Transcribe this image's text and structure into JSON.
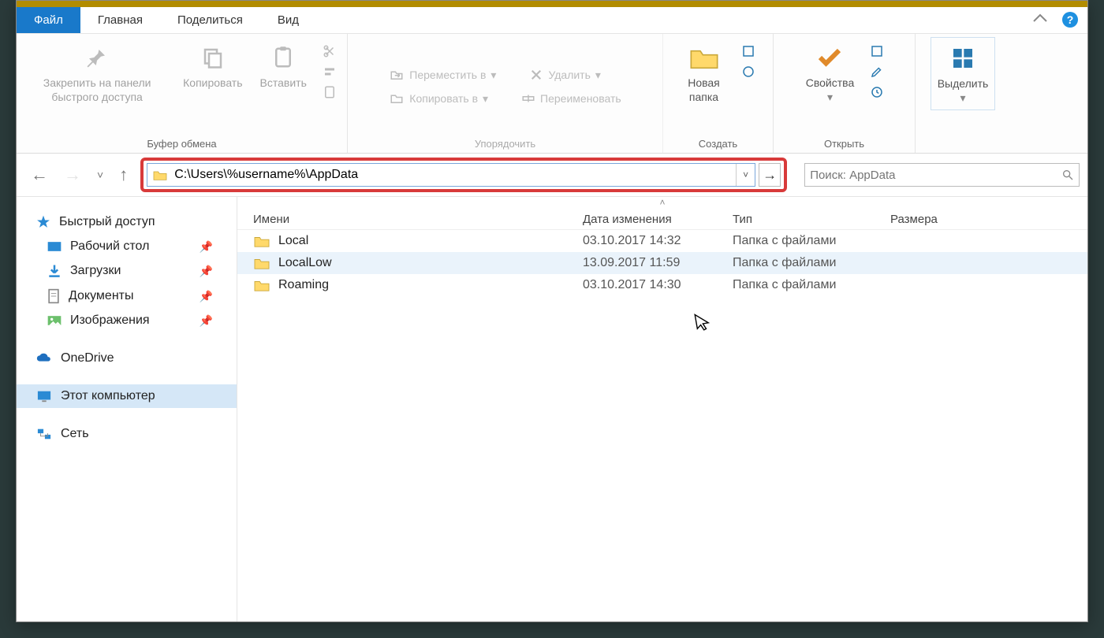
{
  "tabs": {
    "file": "Файл",
    "home": "Главная",
    "share": "Поделиться",
    "view": "Вид"
  },
  "ribbon": {
    "clipboard": {
      "pin": "Закрепить на панели\nбыстрого доступа",
      "copy": "Копировать",
      "paste": "Вставить",
      "label": "Буфер обмена"
    },
    "organize": {
      "moveTo": "Переместить в",
      "copyTo": "Копировать в",
      "delete": "Удалить",
      "rename": "Переименовать",
      "label": "Упорядочить"
    },
    "new": {
      "newFolder": "Новая\nпапка",
      "label": "Создать"
    },
    "open": {
      "properties": "Свойства",
      "label": "Открыть"
    },
    "select": {
      "select": "Выделить",
      "label": ""
    }
  },
  "nav": {
    "path": "C:\\Users\\%username%\\AppData",
    "searchPlaceholder": "Поиск: AppData"
  },
  "columns": {
    "name": "Имени",
    "date": "Дата изменения",
    "type": "Тип",
    "size": "Размера"
  },
  "sidebar": {
    "quickAccess": "Быстрый доступ",
    "desktop": "Рабочий стол",
    "downloads": "Загрузки",
    "documents": "Документы",
    "pictures": "Изображения",
    "onedrive": "OneDrive",
    "thispc": "Этот компьютер",
    "network": "Сеть"
  },
  "rows": [
    {
      "name": "Local",
      "date": "03.10.2017 14:32",
      "type": "Папка с файлами"
    },
    {
      "name": "LocalLow",
      "date": "13.09.2017 11:59",
      "type": "Папка с файлами"
    },
    {
      "name": "Roaming",
      "date": "03.10.2017 14:30",
      "type": "Папка с файлами"
    }
  ]
}
